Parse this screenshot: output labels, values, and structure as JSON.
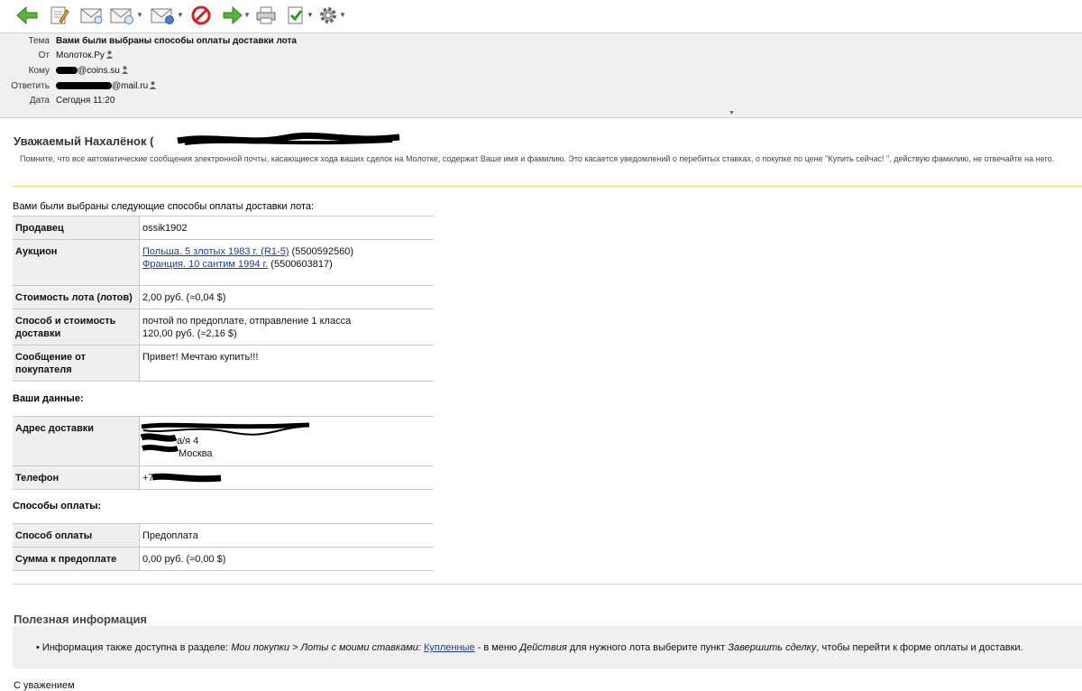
{
  "toolbar": {
    "buttons": [
      {
        "icon": "back-arrow-icon",
        "dropdown": false
      },
      {
        "icon": "compose-icon",
        "dropdown": false
      },
      {
        "icon": "reply-icon",
        "dropdown": false
      },
      {
        "icon": "reply-all-icon",
        "dropdown": true
      },
      {
        "icon": "forward-icon",
        "dropdown": true
      },
      {
        "icon": "delete-icon",
        "dropdown": false
      },
      {
        "icon": "next-arrow-icon",
        "dropdown": true
      },
      {
        "icon": "print-icon",
        "dropdown": false
      },
      {
        "icon": "spam-check-icon",
        "dropdown": true
      },
      {
        "icon": "settings-gear-icon",
        "dropdown": true
      }
    ]
  },
  "header": {
    "subject_label": "Тема",
    "subject": "Вами были выбраны способы оплаты доставки лота",
    "from_label": "От",
    "from": "Молоток.Ру",
    "to_label": "Кому",
    "to_visible": "@coins.su",
    "reply_label": "Ответить",
    "reply_visible": "@mail.ru",
    "date_label": "Дата",
    "date": "Сегодня 11:20"
  },
  "greeting": "Уважаемый Нахалёнок (",
  "notice": "Помните, что все автоматические сообщения электронной почты, касающиеся хода ваших сделок на Молотке, содержат Ваше имя и фамилию. Это касается уведомлений о перебитых ставках, о покупке по цене \"Купить сейчас! \", действую фамилию, не отвечайте на него.",
  "intro": "Вами были выбраны следующие способы оплаты доставки лота:",
  "lot": {
    "seller_label": "Продавец",
    "seller": "ossik1902",
    "auction_label": "Аукцион",
    "auction_link1": "Польша. 5 злотых 1983 г. (R1-5)",
    "auction_id1": " (5500592560)",
    "auction_link2": "Франция. 10 сантим 1994 г.",
    "auction_id2": " (5500603817)",
    "cost_label": "Стоимость лота (лотов)",
    "cost": "2,00 руб. (≈0,04 $)",
    "delivery_label": "Способ и стоимость доставки",
    "delivery_method": "почтой по предоплате, отправление 1 класса",
    "delivery_cost": "120,00 руб. (≈2,16 $)",
    "message_label": "Сообщение от покупателя",
    "message": "Привет! Мечтаю купить!!!"
  },
  "your_data": {
    "title": "Ваши данные:",
    "address_label": "Адрес доставки",
    "address_line2": "а/я 4",
    "address_line3": "Москва",
    "phone_label": "Телефон",
    "phone_visible": "+7"
  },
  "payment": {
    "title": "Способы оплаты:",
    "method_label": "Способ оплаты",
    "method": "Предоплата",
    "sum_label": "Сумма к предоплате",
    "sum": "0,00 руб. (≈0,00 $)"
  },
  "useful": {
    "title": "Полезная информация",
    "t1": "Информация также доступна в разделе: ",
    "i1": "Мои покупки > Лоты с моими ставками: ",
    "link": "Купленные",
    "t2": " - в меню ",
    "i2": "Действия",
    "t3": " для нужного лота выберите пункт ",
    "i3": "Завершить сделку",
    "t4": ", чтобы перейти к форме оплаты и доставки."
  },
  "closing": "С уважением"
}
